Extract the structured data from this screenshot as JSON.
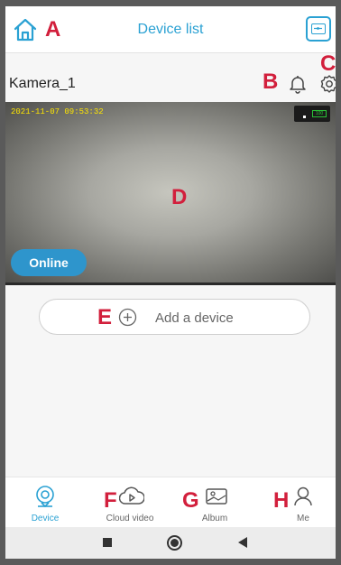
{
  "header": {
    "title": "Device list",
    "home_icon": "home-icon",
    "scan_icon": "scan-icon"
  },
  "markers": {
    "a": "A",
    "b": "B",
    "c": "C",
    "d": "D",
    "e": "E",
    "f": "F",
    "g": "G",
    "h": "H"
  },
  "device": {
    "name": "Kamera_1",
    "bell_icon": "bell-icon",
    "settings_icon": "gear-icon",
    "timestamp": "2021-11-07 09:53:32",
    "battery": "100",
    "status": "Online"
  },
  "add_device": {
    "label": "Add a device",
    "icon": "plus-circle-icon"
  },
  "nav": [
    {
      "label": "Device",
      "icon": "camera-icon",
      "active": true
    },
    {
      "label": "Cloud video",
      "icon": "cloud-play-icon",
      "active": false
    },
    {
      "label": "Album",
      "icon": "photo-icon",
      "active": false
    },
    {
      "label": "Me",
      "icon": "user-icon",
      "active": false
    }
  ],
  "colors": {
    "accent": "#2aa1d3",
    "marker": "#d21f3c",
    "online_badge": "#2e95cc",
    "battery": "#29c436"
  }
}
